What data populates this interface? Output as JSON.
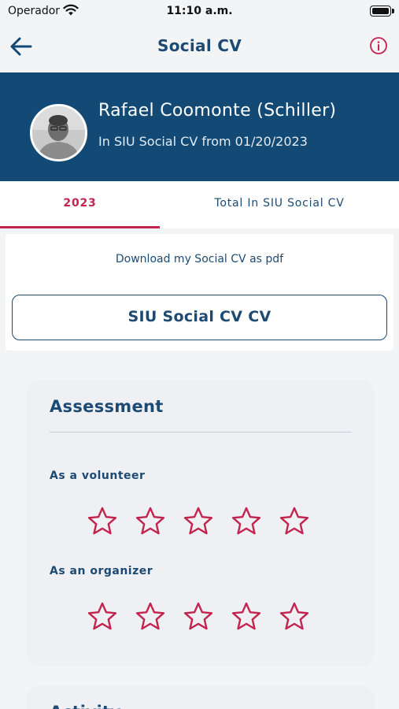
{
  "status_bar": {
    "carrier": "Operador",
    "time": "11:10 a.m."
  },
  "nav": {
    "title": "Social CV",
    "back_icon": "arrow-left-icon",
    "info_icon": "info-circle-icon"
  },
  "profile": {
    "name": "Rafael Coomonte (Schiller)",
    "since": "In SIU Social CV from 01/20/2023"
  },
  "tabs": [
    {
      "label": "2023",
      "active": true
    },
    {
      "label": "Total In SIU Social CV",
      "active": false
    }
  ],
  "download": {
    "label": "Download my Social CV as pdf",
    "button_label": "SIU Social CV CV"
  },
  "assessment": {
    "title": "Assessment",
    "ratings": [
      {
        "label": "As a volunteer",
        "stars_filled": 0,
        "stars_total": 5
      },
      {
        "label": "As an organizer",
        "stars_filled": 0,
        "stars_total": 5
      }
    ]
  },
  "activity": {
    "title": "Activity"
  },
  "colors": {
    "primary": "#134a75",
    "text": "#1d4a72",
    "accent": "#c2244e",
    "background": "#f3f4f6"
  }
}
